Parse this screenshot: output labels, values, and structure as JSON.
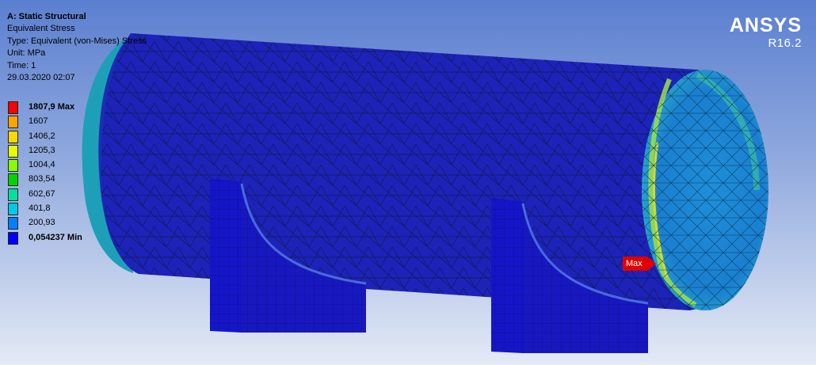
{
  "info": {
    "system": "A: Static Structural",
    "result": "Equivalent Stress",
    "type": "Type: Equivalent (von-Mises) Stress",
    "unit": "Unit: MPa",
    "time": "Time: 1",
    "date": "29.03.2020 02:07"
  },
  "legend": [
    {
      "label": "1807,9 Max",
      "color": "#ff0000"
    },
    {
      "label": "1607",
      "color": "#ffa500"
    },
    {
      "label": "1406,2",
      "color": "#ffd700"
    },
    {
      "label": "1205,3",
      "color": "#e6ff00"
    },
    {
      "label": "1004,4",
      "color": "#88ff00"
    },
    {
      "label": "803,54",
      "color": "#00d500"
    },
    {
      "label": "602,67",
      "color": "#00e0a0"
    },
    {
      "label": "401,8",
      "color": "#00c8e6"
    },
    {
      "label": "200,93",
      "color": "#0080ff"
    },
    {
      "label": "0,054237 Min",
      "color": "#0000ff"
    }
  ],
  "logo": {
    "brand": "ANSYS",
    "version": "R16.2"
  },
  "probe": {
    "label": "Max"
  }
}
